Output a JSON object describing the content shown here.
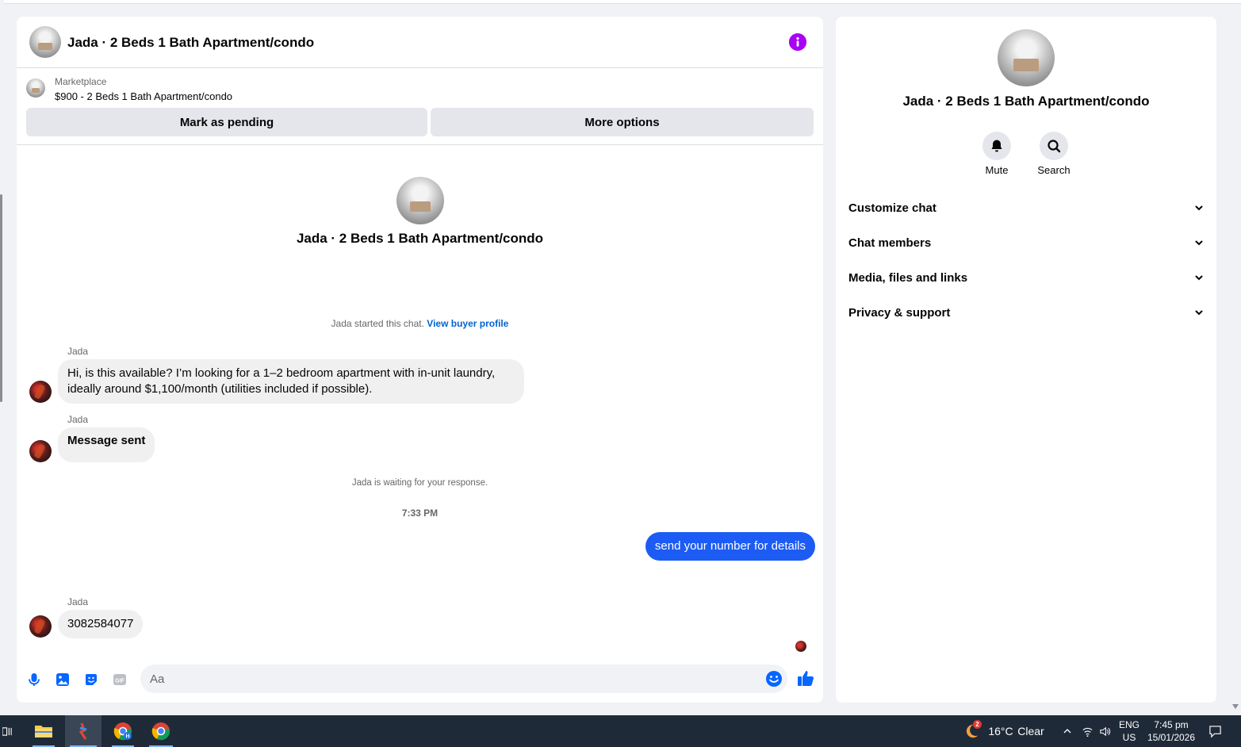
{
  "header": {
    "title": "Jada · 2 Beds 1 Bath Apartment/condo",
    "info_icon": "info-icon"
  },
  "marketplace": {
    "label": "Marketplace",
    "item": "$900 - 2 Beds 1 Bath Apartment/condo",
    "pending_label": "Mark as pending",
    "more_label": "More options"
  },
  "conversation": {
    "title": "Jada · 2 Beds 1 Bath Apartment/condo",
    "started_text": "Jada started this chat.",
    "view_profile_label": "View buyer profile",
    "waiting_text": "Jada is waiting for your response.",
    "timestamp": "7:33 PM",
    "messages": [
      {
        "sender": "Jada",
        "text": "Hi, is this available? I’m looking for a 1–2 bedroom apartment with in-unit laundry, ideally around $1,100/month (utilities included if possible)."
      },
      {
        "sender": "Jada",
        "text": "Message sent"
      },
      {
        "sender": "You",
        "text": "send your number for details"
      },
      {
        "sender": "Jada",
        "text": "3082584077"
      }
    ]
  },
  "composer": {
    "placeholder": "Aa",
    "icons": [
      "microphone-icon",
      "image-icon",
      "sticker-icon",
      "gif-icon",
      "emoji-icon",
      "like-icon"
    ],
    "gif_label": "GIF"
  },
  "info_panel": {
    "title": "Jada · 2 Beds 1 Bath Apartment/condo",
    "actions": [
      {
        "label": "Mute",
        "icon": "bell-icon"
      },
      {
        "label": "Search",
        "icon": "search-icon"
      }
    ],
    "sections": [
      {
        "label": "Customize chat"
      },
      {
        "label": "Chat members"
      },
      {
        "label": "Media, files and links"
      },
      {
        "label": "Privacy & support"
      }
    ]
  },
  "taskbar": {
    "weather_temp": "16°C",
    "weather_desc": "Clear",
    "weather_badge": "2",
    "lang_top": "ENG",
    "lang_bottom": "US",
    "time": "7:45 pm",
    "date": "15/01/2026",
    "chrome_badge": "H"
  },
  "colors": {
    "accent_blue": "#1c5cf5",
    "info_purple": "#a700f5",
    "link_blue": "#0064d1",
    "taskbar_bg": "#1f2a38"
  }
}
